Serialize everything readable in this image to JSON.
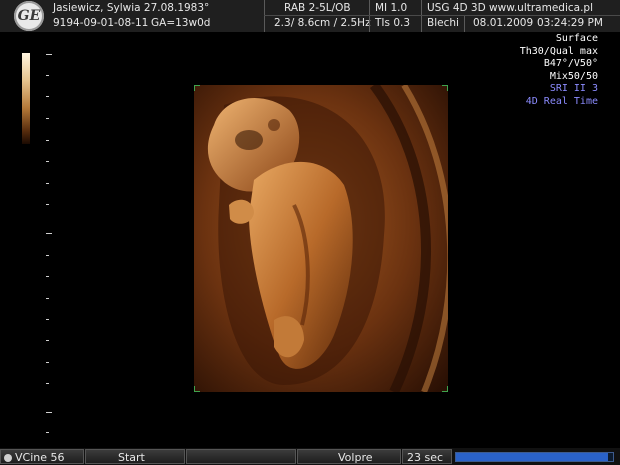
{
  "header": {
    "brand": "GE",
    "patient": "Jasiewicz, Sylwia 27.08.1983°",
    "exam_id": "9194-09-01-08-11",
    "ga": "GA=13w0d",
    "probe": "RAB 2-5L/OB",
    "depth_freq": "2.3/ 8.6cm / 2.5Hz",
    "mi": "MI  1.0",
    "tis": "TIs  0.3",
    "site": "USG 4D 3D www.ultramedica.pl",
    "operator": "Blechi",
    "date": "08.01.2009",
    "time": "03:24:29 PM"
  },
  "params": [
    "Surface",
    "Th30/Qual max",
    "B47°/V50°",
    "Mix50/50",
    "SRI II 3",
    "4D Real Time"
  ],
  "colors": {
    "accent_blue": "#8c8cff",
    "roi_corner": "#3fa34d",
    "progress": "#2a62c8",
    "tint_light": "#e2a35a",
    "tint_dark": "#2a1004"
  },
  "footer": {
    "vcine": "VCine 56",
    "start": "Start",
    "volpre": "Volpre",
    "duration": "23 sec",
    "progress_fraction": 0.97
  }
}
